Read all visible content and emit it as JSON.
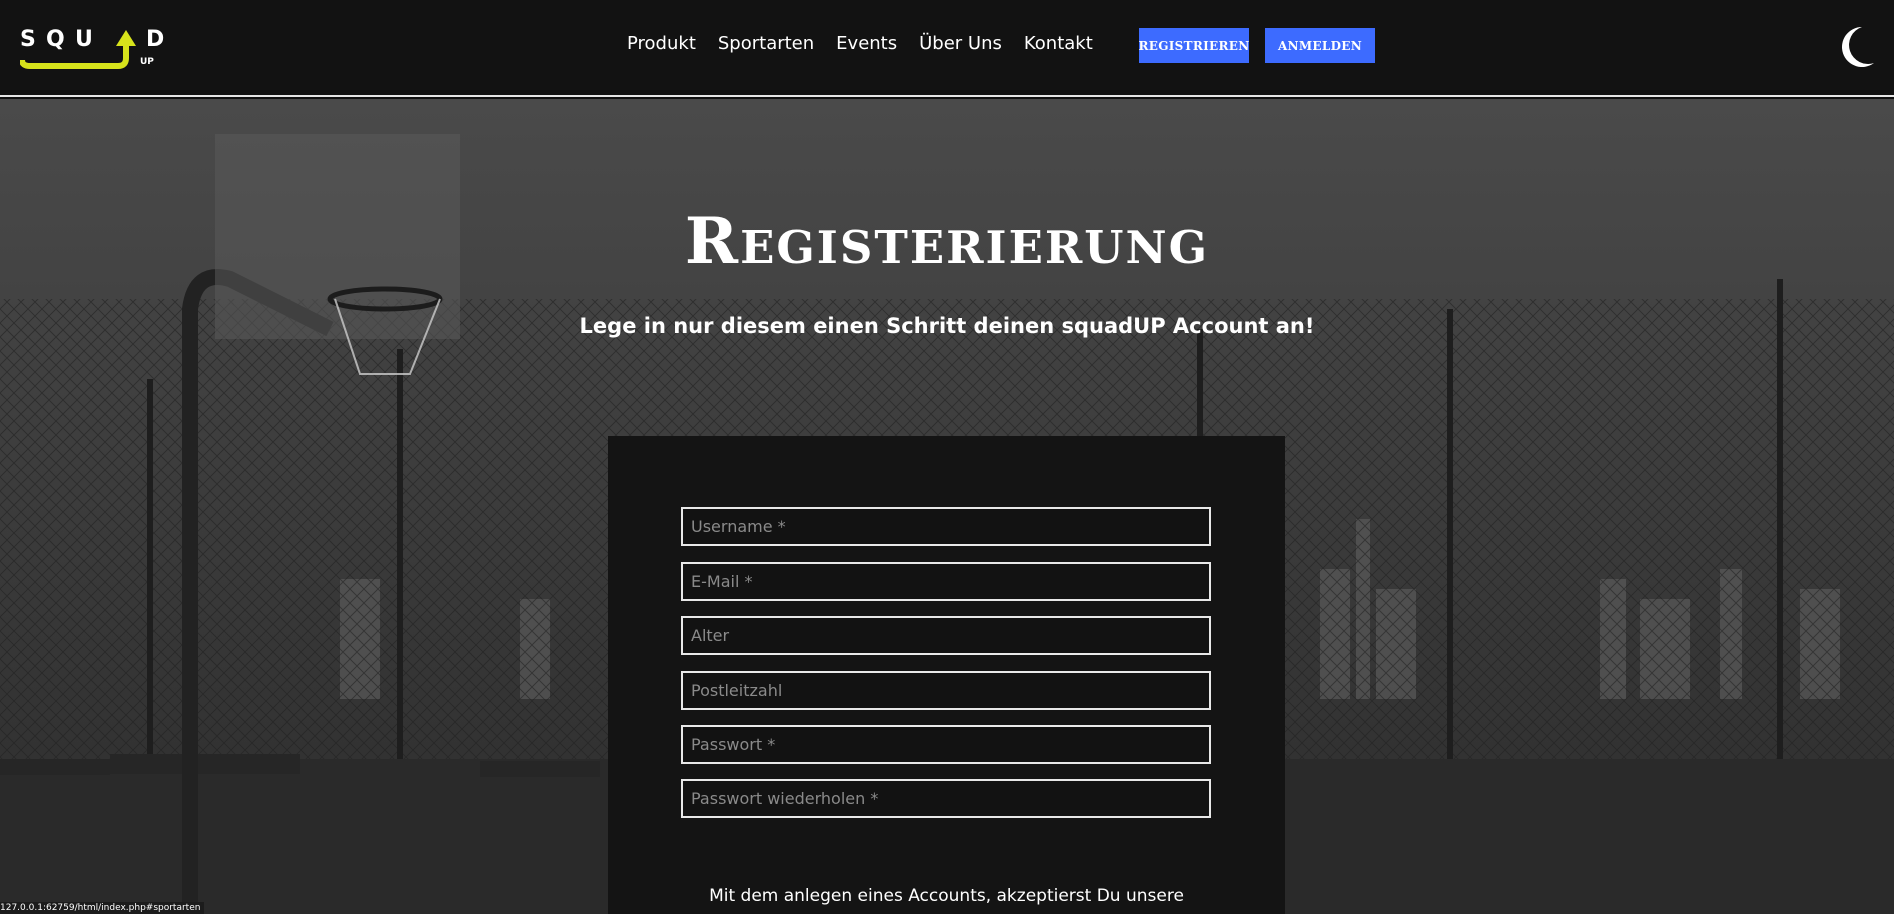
{
  "colors": {
    "accent": "#3d6bff",
    "logo_yellow": "#d7e31b",
    "header_bg": "#121212",
    "card_bg": "#141414"
  },
  "header": {
    "logo_text": "SQUAD",
    "logo_sub": "UP",
    "nav": [
      "Produkt",
      "Sportarten",
      "Events",
      "Über Uns",
      "Kontakt"
    ],
    "register_label": "Registrieren",
    "login_label": "Anmelden",
    "theme_icon": "moon-icon"
  },
  "hero": {
    "title": "Registerierung",
    "subtitle": "Lege in nur diesem einen Schritt deinen squadUP Account an!"
  },
  "form": {
    "username_placeholder": "Username *",
    "email_placeholder": "E-Mail *",
    "age_placeholder": "Alter",
    "zip_placeholder": "Postleitzahl",
    "password_placeholder": "Passwort *",
    "password_repeat_placeholder": "Passwort wiederholen *",
    "terms_text": "Mit dem anlegen eines Accounts, akzeptierst Du unsere"
  },
  "status_bar": {
    "url": "127.0.0.1:62759/html/index.php#sportarten"
  }
}
